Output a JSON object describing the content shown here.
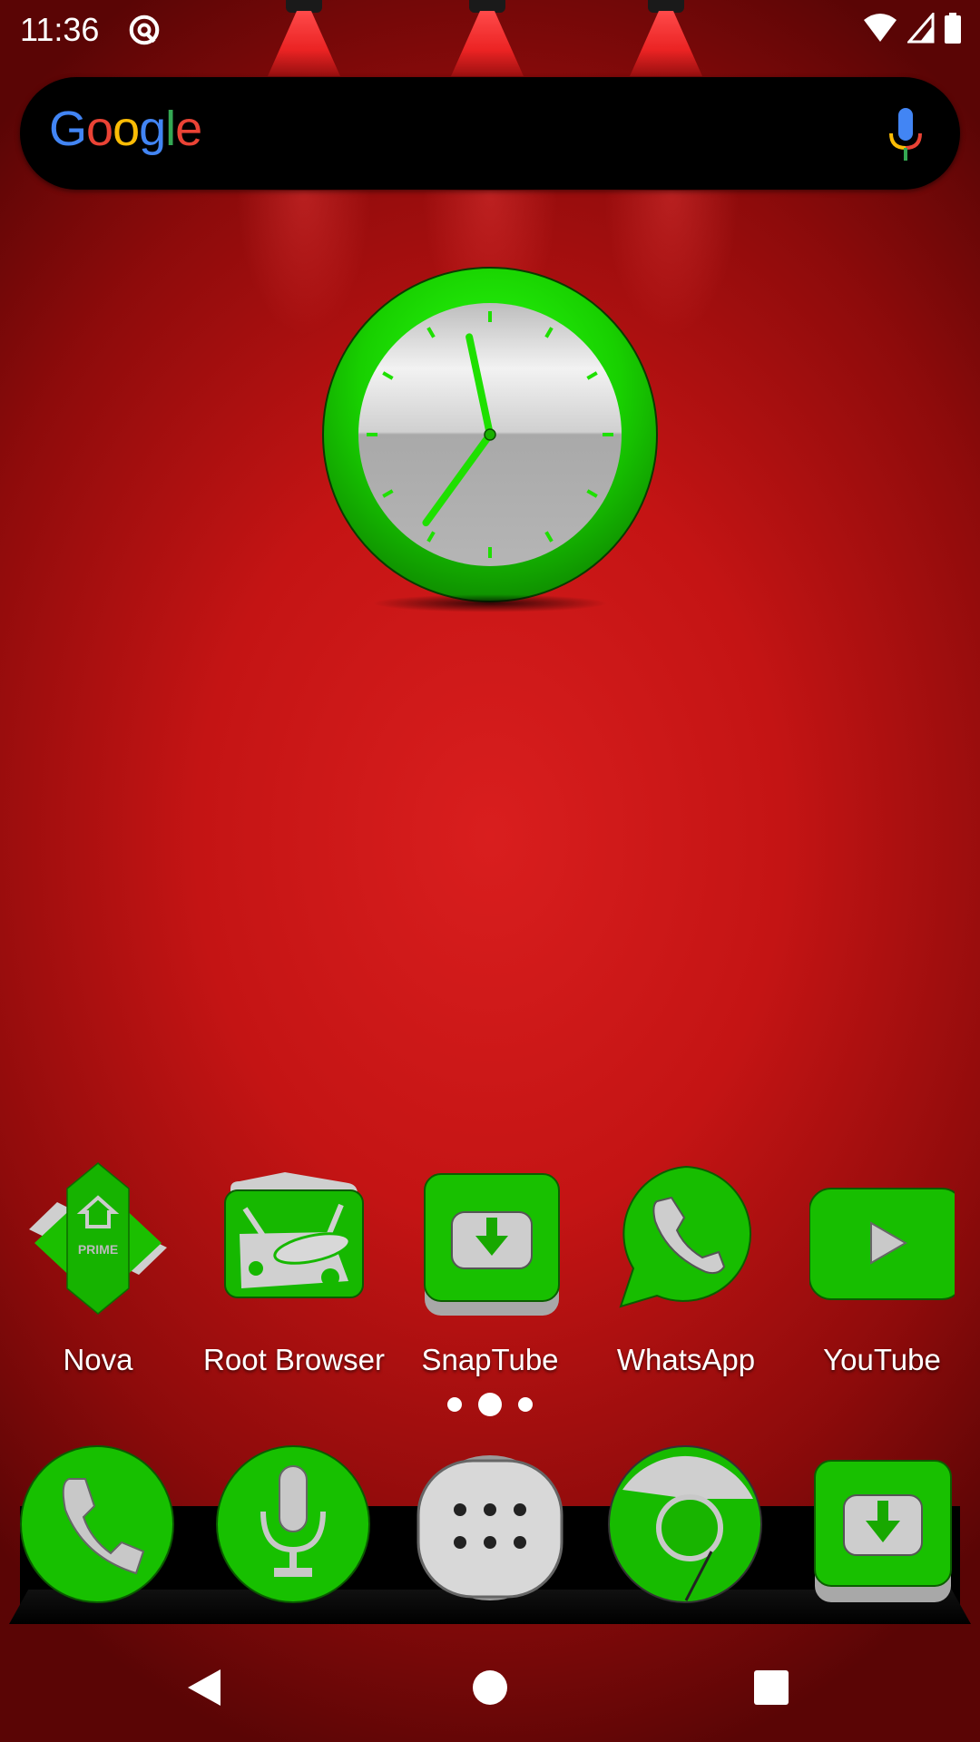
{
  "status_bar": {
    "time": "11:36",
    "notification_icon": "at-sign-circle-icon",
    "right_icons": [
      "wifi-icon",
      "cell-signal-icon",
      "battery-icon"
    ]
  },
  "search_widget": {
    "logo_letters": [
      {
        "char": "G",
        "color": "#4285F4"
      },
      {
        "char": "o",
        "color": "#EA4335"
      },
      {
        "char": "o",
        "color": "#FBBC05"
      },
      {
        "char": "g",
        "color": "#4285F4"
      },
      {
        "char": "l",
        "color": "#34A853"
      },
      {
        "char": "e",
        "color": "#EA4335"
      }
    ],
    "mic_icon": "google-mic-icon"
  },
  "clock_widget": {
    "type": "analog",
    "hour": 11,
    "minute": 36,
    "ring_color": "#11cc00",
    "hand_color": "#1ee000"
  },
  "home_apps": [
    {
      "label": "Nova",
      "icon": "nova-prime-icon"
    },
    {
      "label": "Root Browser",
      "icon": "root-browser-icon"
    },
    {
      "label": "SnapTube",
      "icon": "snaptube-icon"
    },
    {
      "label": "WhatsApp",
      "icon": "whatsapp-icon"
    },
    {
      "label": "YouTube",
      "icon": "youtube-icon"
    }
  ],
  "page_indicator": {
    "count": 3,
    "active": 2
  },
  "dock": [
    {
      "name": "Phone",
      "icon": "phone-icon"
    },
    {
      "name": "Voice Search",
      "icon": "microphone-icon"
    },
    {
      "name": "App Drawer",
      "icon": "app-drawer-icon"
    },
    {
      "name": "Chrome",
      "icon": "chrome-icon"
    },
    {
      "name": "Downloader",
      "icon": "download-icon"
    }
  ],
  "nav_bar": [
    "back",
    "home",
    "recents"
  ],
  "theme": {
    "accent_green": "#12c400",
    "wallpaper_red": "#c41414",
    "chrome_silver": "#c8c8c8"
  }
}
